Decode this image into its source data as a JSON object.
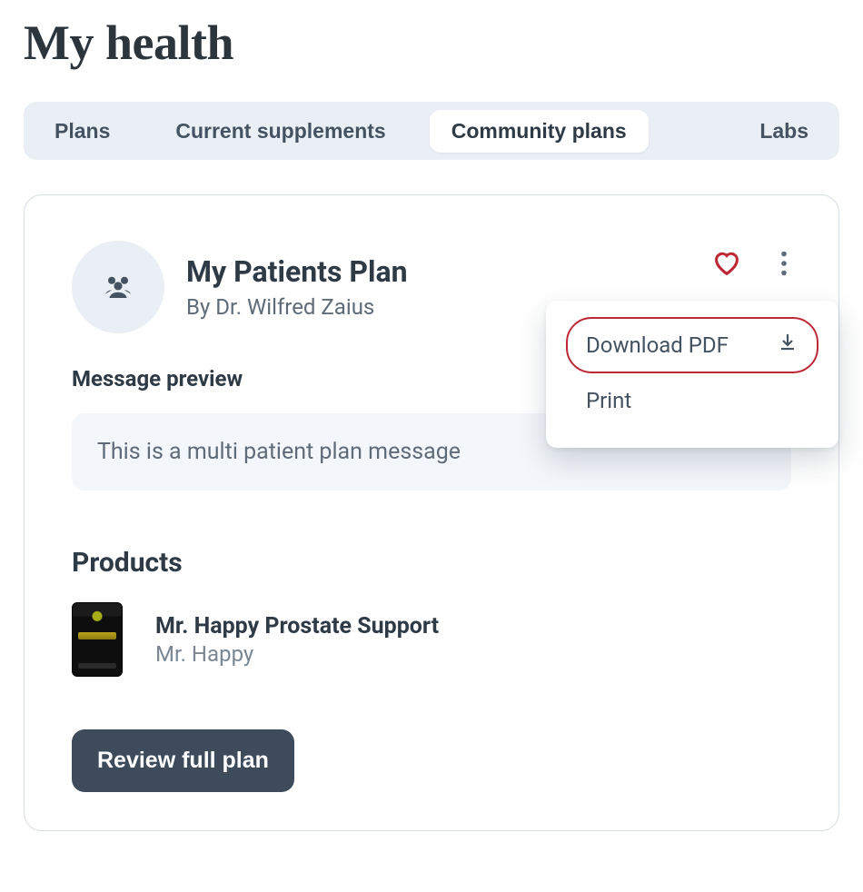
{
  "page": {
    "title": "My health"
  },
  "tabs": [
    {
      "id": "plans",
      "label": "Plans",
      "active": false
    },
    {
      "id": "supplements",
      "label": "Current supplements",
      "active": false
    },
    {
      "id": "community",
      "label": "Community plans",
      "active": true
    },
    {
      "id": "labs",
      "label": "Labs",
      "active": false
    }
  ],
  "plan_card": {
    "avatar_icon": "people-group-icon",
    "title": "My Patients Plan",
    "byline": "By Dr. Wilfred Zaius",
    "actions": {
      "favorite_icon": "heart-icon",
      "more_icon": "kebab-icon"
    },
    "more_menu": {
      "items": [
        {
          "id": "download",
          "label": "Download PDF",
          "selected": true,
          "icon": "download-icon"
        },
        {
          "id": "print",
          "label": "Print",
          "selected": false,
          "icon": null
        }
      ]
    },
    "message_preview": {
      "label": "Message preview",
      "body": "This is a multi patient plan message"
    },
    "products": {
      "label": "Products",
      "items": [
        {
          "name": "Mr. Happy Prostate Support",
          "brand": "Mr. Happy"
        }
      ]
    },
    "cta_label": "Review full plan"
  }
}
